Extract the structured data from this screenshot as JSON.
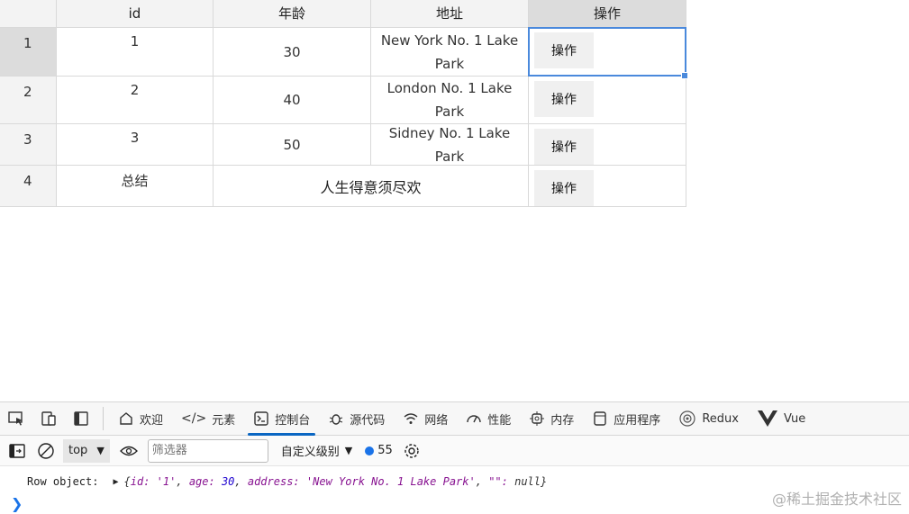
{
  "grid": {
    "headers": [
      "",
      "id",
      "年龄",
      "地址",
      "操作"
    ],
    "rows": [
      {
        "num": "1",
        "id": "1",
        "age": "30",
        "address": "New York No. 1 Lake Park",
        "op": "操作"
      },
      {
        "num": "2",
        "id": "2",
        "age": "40",
        "address": "London No. 1 Lake Park",
        "op": "操作"
      },
      {
        "num": "3",
        "id": "3",
        "age": "50",
        "address": "Sidney No. 1 Lake Park",
        "op": "操作"
      }
    ],
    "summary": {
      "num": "4",
      "label": "总结",
      "text": "人生得意须尽欢",
      "op": "操作"
    }
  },
  "devtools": {
    "tabs": [
      "欢迎",
      "元素",
      "控制台",
      "源代码",
      "网络",
      "性能",
      "内存",
      "应用程序",
      "Redux",
      "Vue"
    ],
    "active_tab": "控制台",
    "context": "top",
    "filter_placeholder": "筛选器",
    "levels_label": "自定义级别",
    "issues_count": "55",
    "log_label": "Row object:",
    "log_object": {
      "open": "{",
      "k1": "id:",
      "v1": "'1'",
      "k2": "age:",
      "v2": "30",
      "k3": "address:",
      "v3": "'New York No. 1 Lake Park'",
      "k4": "\"\":",
      "v4": "null",
      "close": "}"
    }
  },
  "watermark": "@稀土掘金技术社区"
}
